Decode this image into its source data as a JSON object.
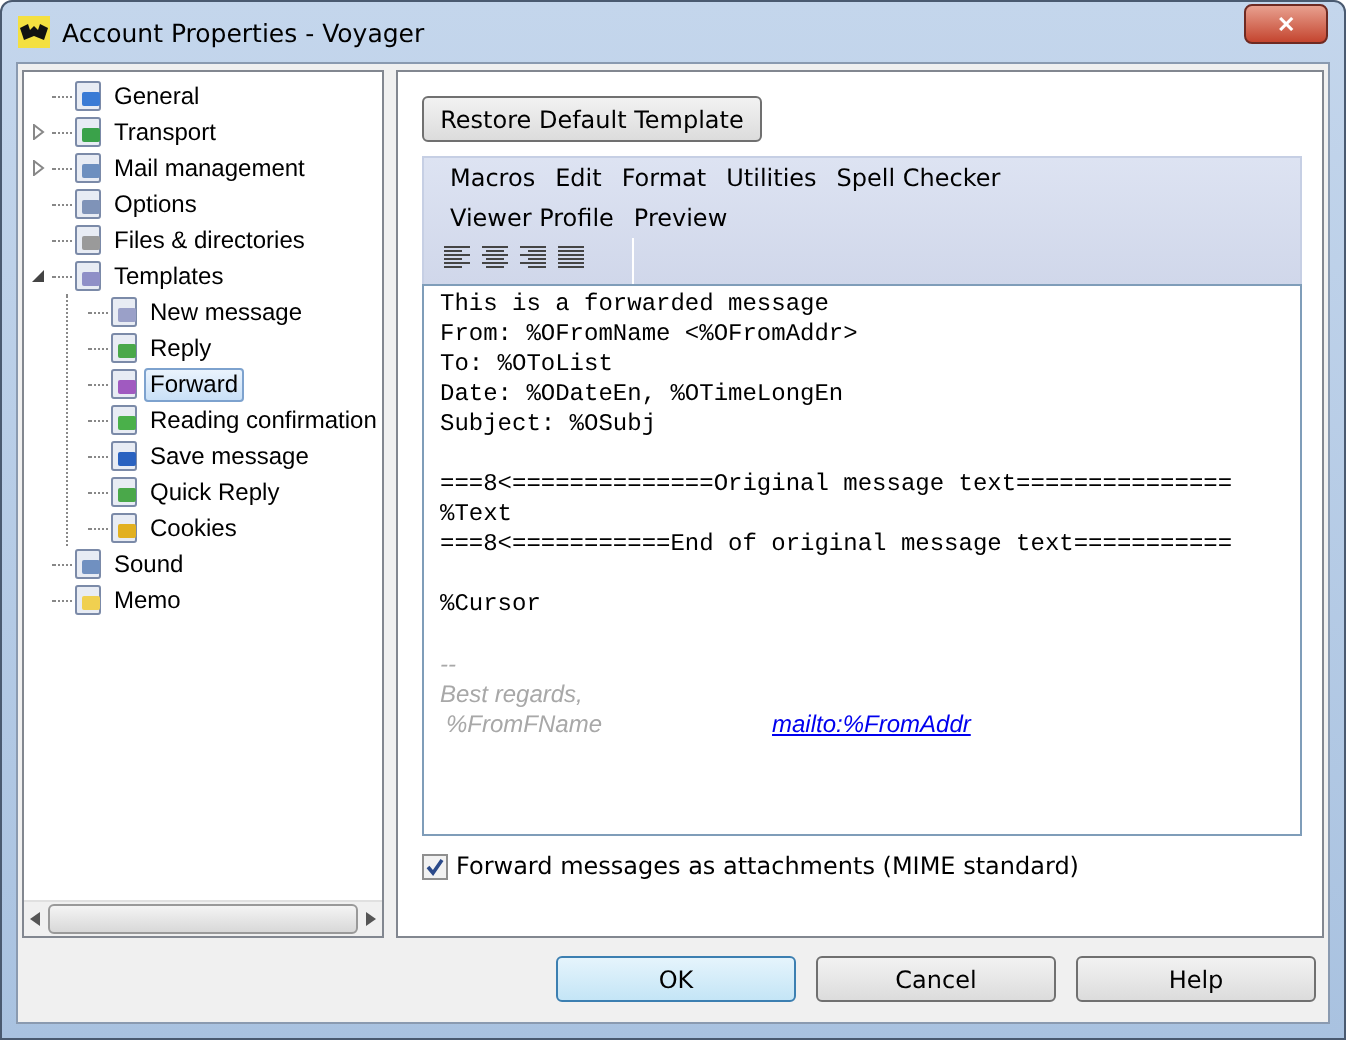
{
  "window": {
    "title": "Account Properties - Voyager",
    "close": "✕"
  },
  "tree": [
    {
      "label": "General",
      "selected": false
    },
    {
      "label": "Transport",
      "selected": false,
      "expanded": false
    },
    {
      "label": "Mail management",
      "selected": false,
      "expanded": false
    },
    {
      "label": "Options",
      "selected": false
    },
    {
      "label": "Files & directories",
      "selected": false
    },
    {
      "label": "Templates",
      "selected": false,
      "expanded": true,
      "children": [
        {
          "label": "New message",
          "selected": false
        },
        {
          "label": "Reply",
          "selected": false
        },
        {
          "label": "Forward",
          "selected": true
        },
        {
          "label": "Reading confirmation",
          "selected": false
        },
        {
          "label": "Save message",
          "selected": false
        },
        {
          "label": "Quick Reply",
          "selected": false
        },
        {
          "label": "Cookies",
          "selected": false
        }
      ]
    },
    {
      "label": "Sound",
      "selected": false
    },
    {
      "label": "Memo",
      "selected": false
    }
  ],
  "restore_button": "Restore Default Template",
  "menu_rows": [
    [
      "Macros",
      "Edit",
      "Format",
      "Utilities",
      "Spell Checker"
    ],
    [
      "Viewer Profile",
      "Preview"
    ]
  ],
  "editor": {
    "blocks": [
      [
        "This is a forwarded message",
        "From: %OFromName <%OFromAddr>",
        "To: %OToList",
        "Date: %ODateEn, %OTimeLongEn",
        "Subject: %OSubj"
      ],
      [
        "===8<==============Original message text===============",
        "%Text",
        "===8<===========End of original message text==========="
      ],
      [
        "%Cursor"
      ]
    ],
    "signature": {
      "separator": "--",
      "greeting": "Best regards,",
      "name": "%FromFName",
      "link": "mailto:%FromAddr"
    }
  },
  "forward_attachments": {
    "label": "Forward messages as attachments (MIME standard)",
    "checked": true
  },
  "buttons": [
    {
      "label": "OK",
      "default": true
    },
    {
      "label": "Cancel",
      "default": false
    },
    {
      "label": "Help",
      "default": false
    }
  ]
}
